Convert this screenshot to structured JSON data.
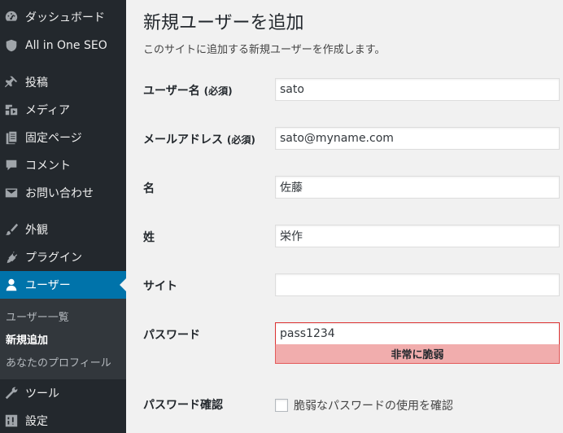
{
  "sidebar": {
    "items": [
      {
        "label": "ダッシュボード",
        "icon": "dashboard-icon"
      },
      {
        "label": "All in One SEO",
        "icon": "shield-icon"
      },
      {
        "label": "投稿",
        "icon": "pushpin-icon"
      },
      {
        "label": "メディア",
        "icon": "media-icon"
      },
      {
        "label": "固定ページ",
        "icon": "pages-icon"
      },
      {
        "label": "コメント",
        "icon": "comment-icon"
      },
      {
        "label": "お問い合わせ",
        "icon": "mail-icon"
      },
      {
        "label": "外観",
        "icon": "paintbrush-icon"
      },
      {
        "label": "プラグイン",
        "icon": "plugin-icon"
      },
      {
        "label": "ユーザー",
        "icon": "user-icon"
      },
      {
        "label": "ツール",
        "icon": "wrench-icon"
      },
      {
        "label": "設定",
        "icon": "settings-icon"
      }
    ],
    "submenu": [
      {
        "label": "ユーザー一覧"
      },
      {
        "label": "新規追加"
      },
      {
        "label": "あなたのプロフィール"
      }
    ]
  },
  "main": {
    "title": "新規ユーザーを追加",
    "description": "このサイトに追加する新規ユーザーを作成します。",
    "fields": {
      "username": {
        "label": "ユーザー名",
        "required": "(必須)",
        "value": "sato"
      },
      "email": {
        "label": "メールアドレス",
        "required": "(必須)",
        "value": "sato@myname.com"
      },
      "first_name": {
        "label": "名",
        "value": "佐藤"
      },
      "last_name": {
        "label": "姓",
        "value": "栄作"
      },
      "website": {
        "label": "サイト",
        "value": ""
      },
      "password": {
        "label": "パスワード",
        "value": "pass1234",
        "strength": "非常に脆弱"
      },
      "password_confirm": {
        "label": "パスワード確認",
        "checkbox_label": "脆弱なパスワードの使用を確認"
      }
    }
  },
  "colors": {
    "sidebar_bg": "#23282d",
    "current_menu": "#0073aa",
    "submenu_bg": "#32373c",
    "weak_bg": "#f1adad",
    "weak_border": "#dc3232"
  }
}
